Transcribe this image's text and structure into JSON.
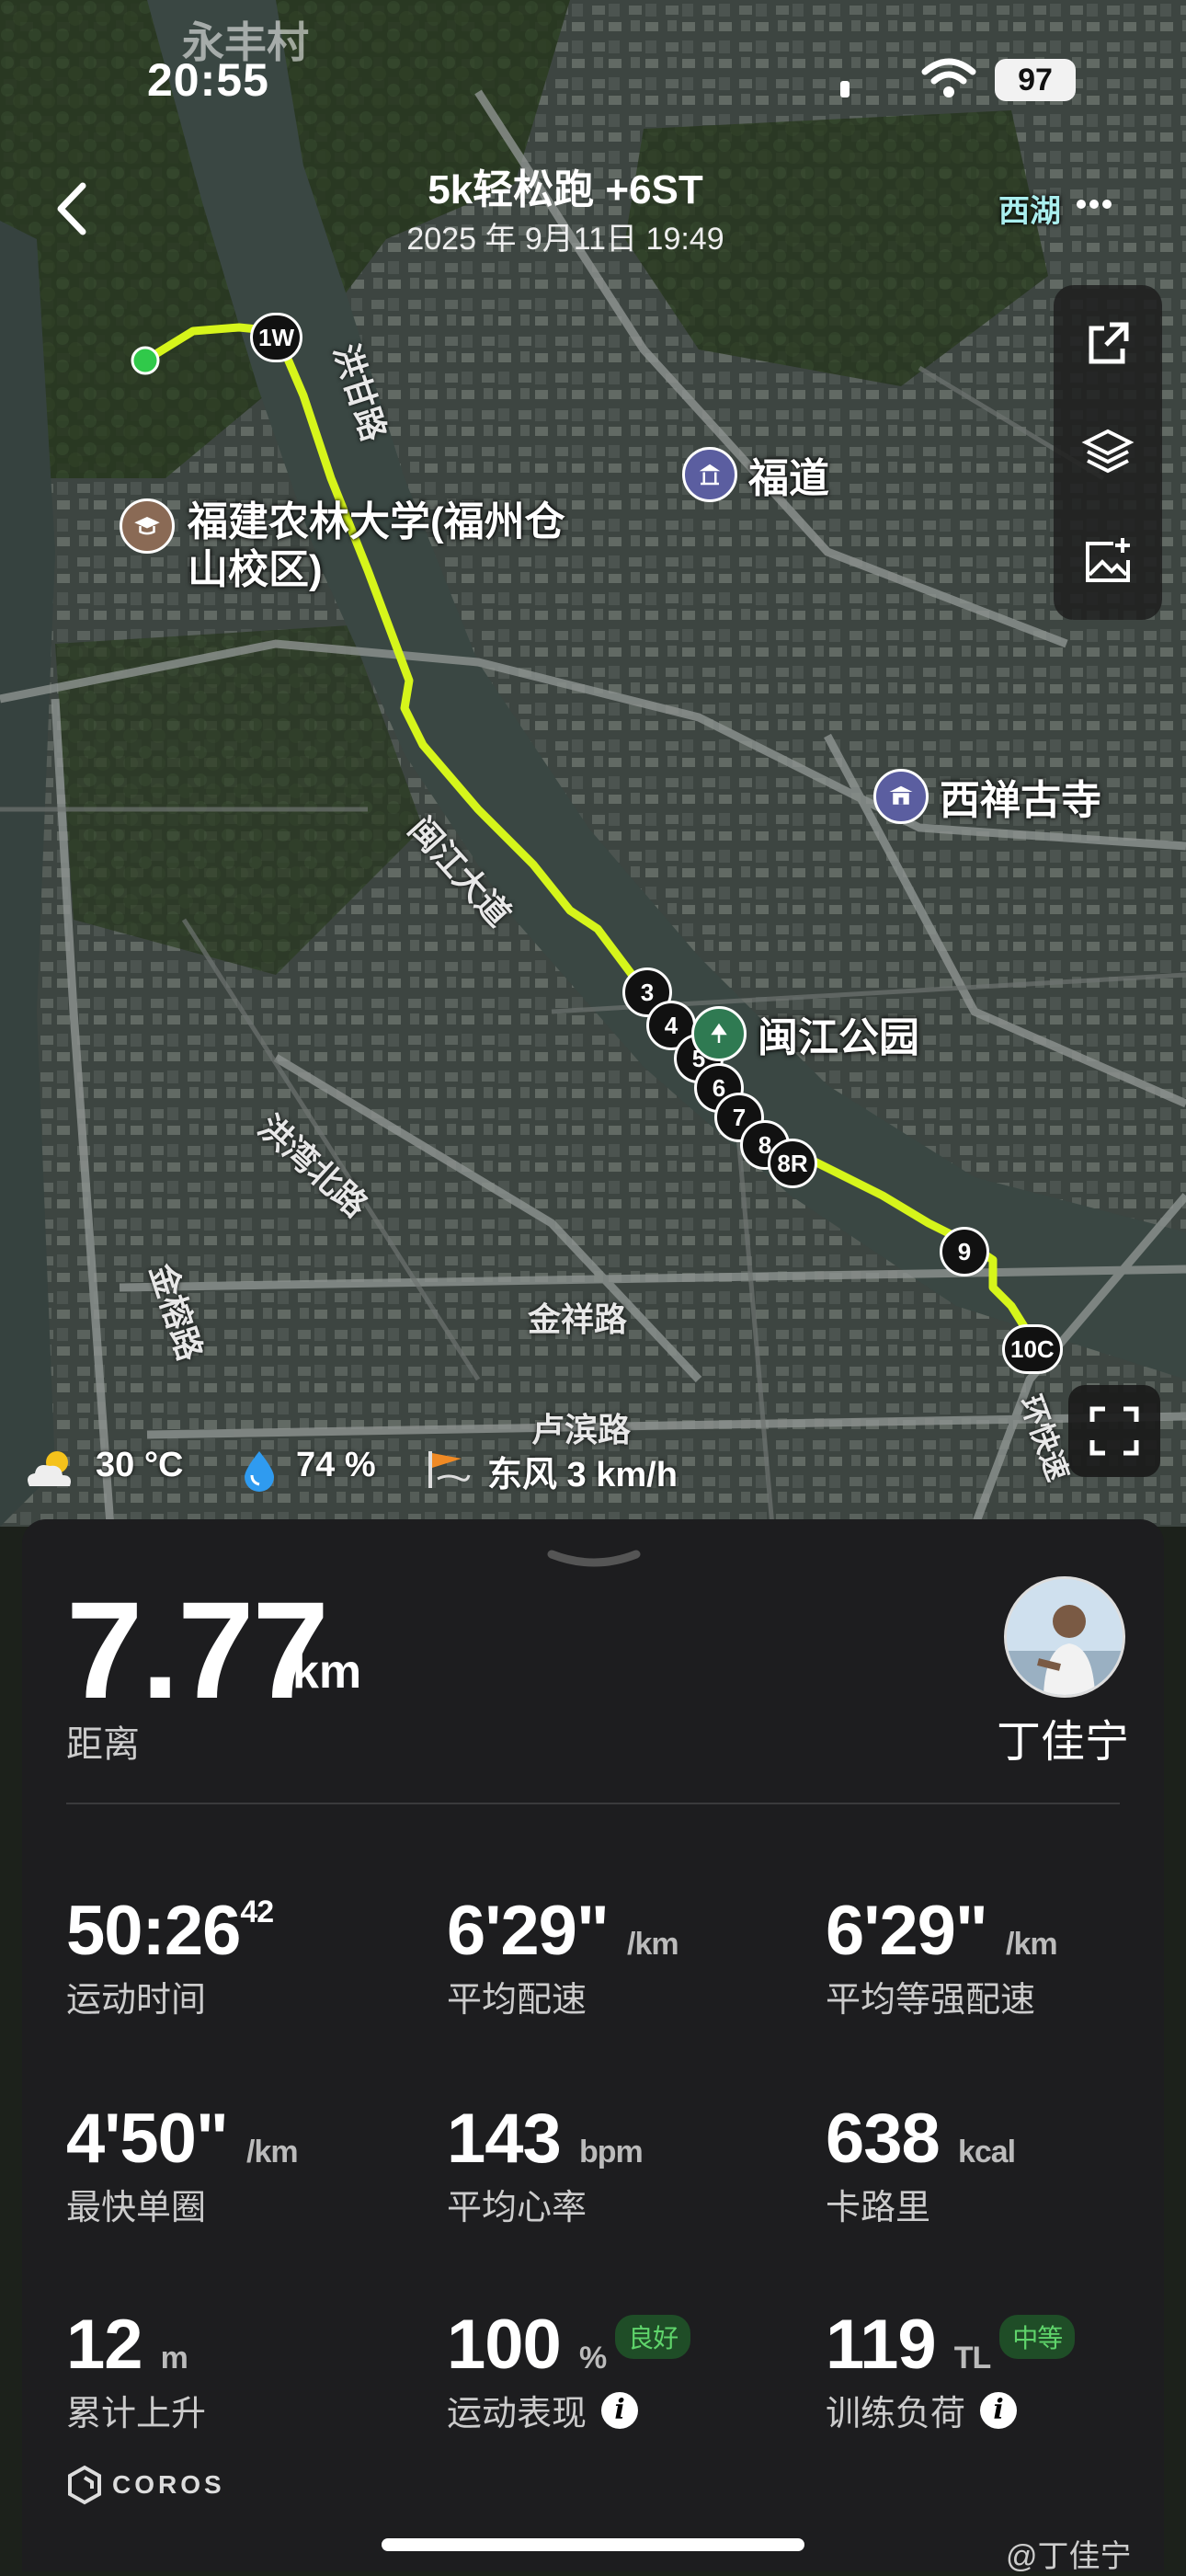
{
  "status_bar": {
    "time": "20:55",
    "battery": "97"
  },
  "map": {
    "village_label": "永丰村",
    "poi_labels": {
      "university": "福建农林大学(福州仓山校区)",
      "fudao": "福道",
      "temple": "西禅古寺",
      "park": "闽江公园",
      "xihu": "西湖"
    },
    "road_labels": {
      "honggan": "洪甘路",
      "minjiang": "闽江大道",
      "hongwan": "洪湾北路",
      "jinxiang": "金祥路",
      "jinzhu": "金榕路",
      "lubin": "卢滨路",
      "huankuai": "环快速"
    },
    "route_color": "#d6f51b",
    "lap_markers": [
      "1W",
      "3",
      "4",
      "5",
      "6",
      "7",
      "8",
      "8R",
      "9",
      "10C"
    ]
  },
  "header": {
    "title": "5k轻松跑 +6ST",
    "date": "2025 年 9月11日 19:49"
  },
  "toolbar": {
    "icons": [
      "share-icon",
      "layers-icon",
      "add-photo-icon"
    ]
  },
  "weather": {
    "temperature": "30 °C",
    "humidity": "74 %",
    "wind": "东风 3 km/h"
  },
  "summary": {
    "distance_value": "7.77",
    "distance_unit": "km",
    "distance_label": "距离",
    "user_name": "丁佳宁"
  },
  "stats": [
    {
      "value": "50:26",
      "sup": "42",
      "unit": "",
      "label": "运动时间"
    },
    {
      "value": "6'29\"",
      "unit": "/km",
      "label": "平均配速"
    },
    {
      "value": "6'29\"",
      "unit": "/km",
      "label": "平均等强配速"
    },
    {
      "value": "4'50\"",
      "unit": "/km",
      "label": "最快单圈"
    },
    {
      "value": "143",
      "unit": "bpm",
      "label": "平均心率"
    },
    {
      "value": "638",
      "unit": "kcal",
      "label": "卡路里"
    },
    {
      "value": "12",
      "unit": "m",
      "label": "累计上升"
    },
    {
      "value": "100",
      "unit": "%",
      "badge": "良好",
      "label": "运动表现"
    },
    {
      "value": "119",
      "unit": "TL",
      "badge": "中等",
      "label": "训练负荷"
    }
  ],
  "brand": "COROS",
  "watermark": "@丁佳宁"
}
